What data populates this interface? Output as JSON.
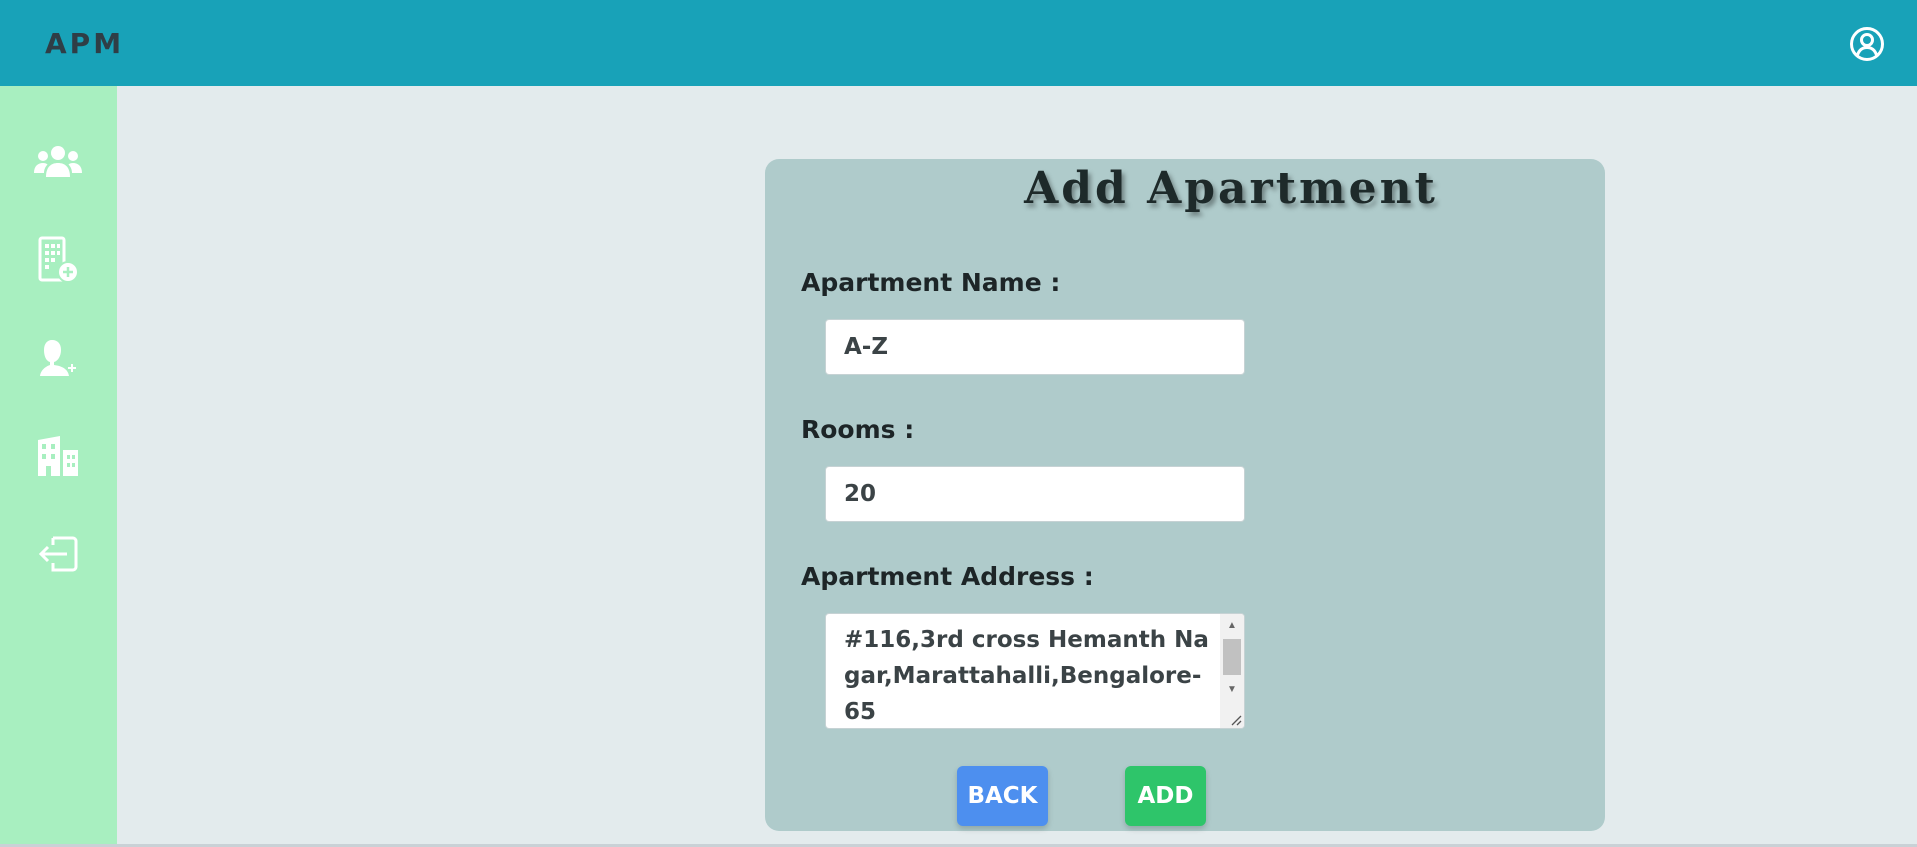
{
  "header": {
    "brand": "APM",
    "account_icon": "user-circle-icon"
  },
  "sidebar": {
    "items": [
      {
        "icon": "users-icon",
        "label": "Users"
      },
      {
        "icon": "add-building-icon",
        "label": "Add Apartment"
      },
      {
        "icon": "add-user-icon",
        "label": "Add Tenant"
      },
      {
        "icon": "buildings-icon",
        "label": "Apartments"
      },
      {
        "icon": "logout-icon",
        "label": "Logout"
      }
    ]
  },
  "form": {
    "title": "Add Apartment",
    "name_label": "Apartment Name :",
    "name_value": "A-Z",
    "rooms_label": "Rooms :",
    "rooms_value": "20",
    "address_label": "Apartment Address :",
    "address_value": "#116,3rd cross Hemanth Nagar,Marattahalli,Bengalore-65",
    "back_label": "BACK",
    "add_label": "ADD"
  },
  "colors": {
    "header": "#18a2b8",
    "sidebar": "#a8efc0",
    "page_background": "#e3ebed",
    "card": "#afcbcb",
    "back_button": "#4d8fef",
    "add_button": "#2ec56a"
  }
}
